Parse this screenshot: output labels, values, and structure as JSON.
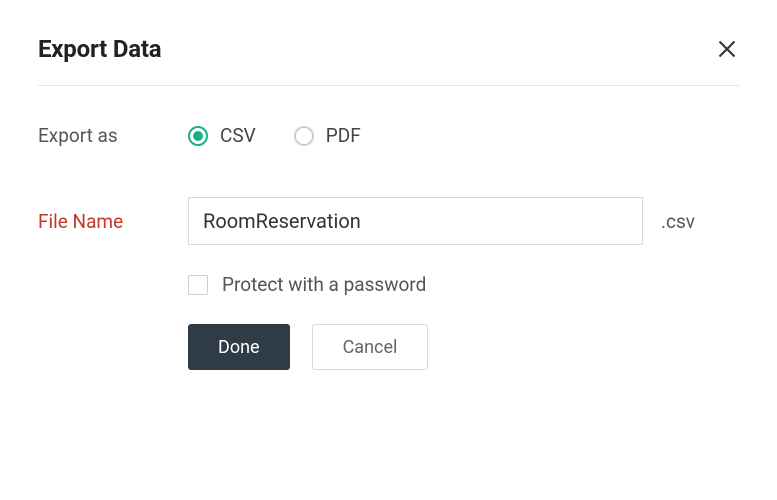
{
  "dialog": {
    "title": "Export Data"
  },
  "exportAs": {
    "label": "Export as",
    "options": {
      "csv": "CSV",
      "pdf": "PDF"
    },
    "selected": "csv"
  },
  "fileName": {
    "label": "File Name",
    "value": "RoomReservation",
    "extension": ".csv"
  },
  "protect": {
    "label": "Protect with a password",
    "checked": false
  },
  "buttons": {
    "done": "Done",
    "cancel": "Cancel"
  }
}
